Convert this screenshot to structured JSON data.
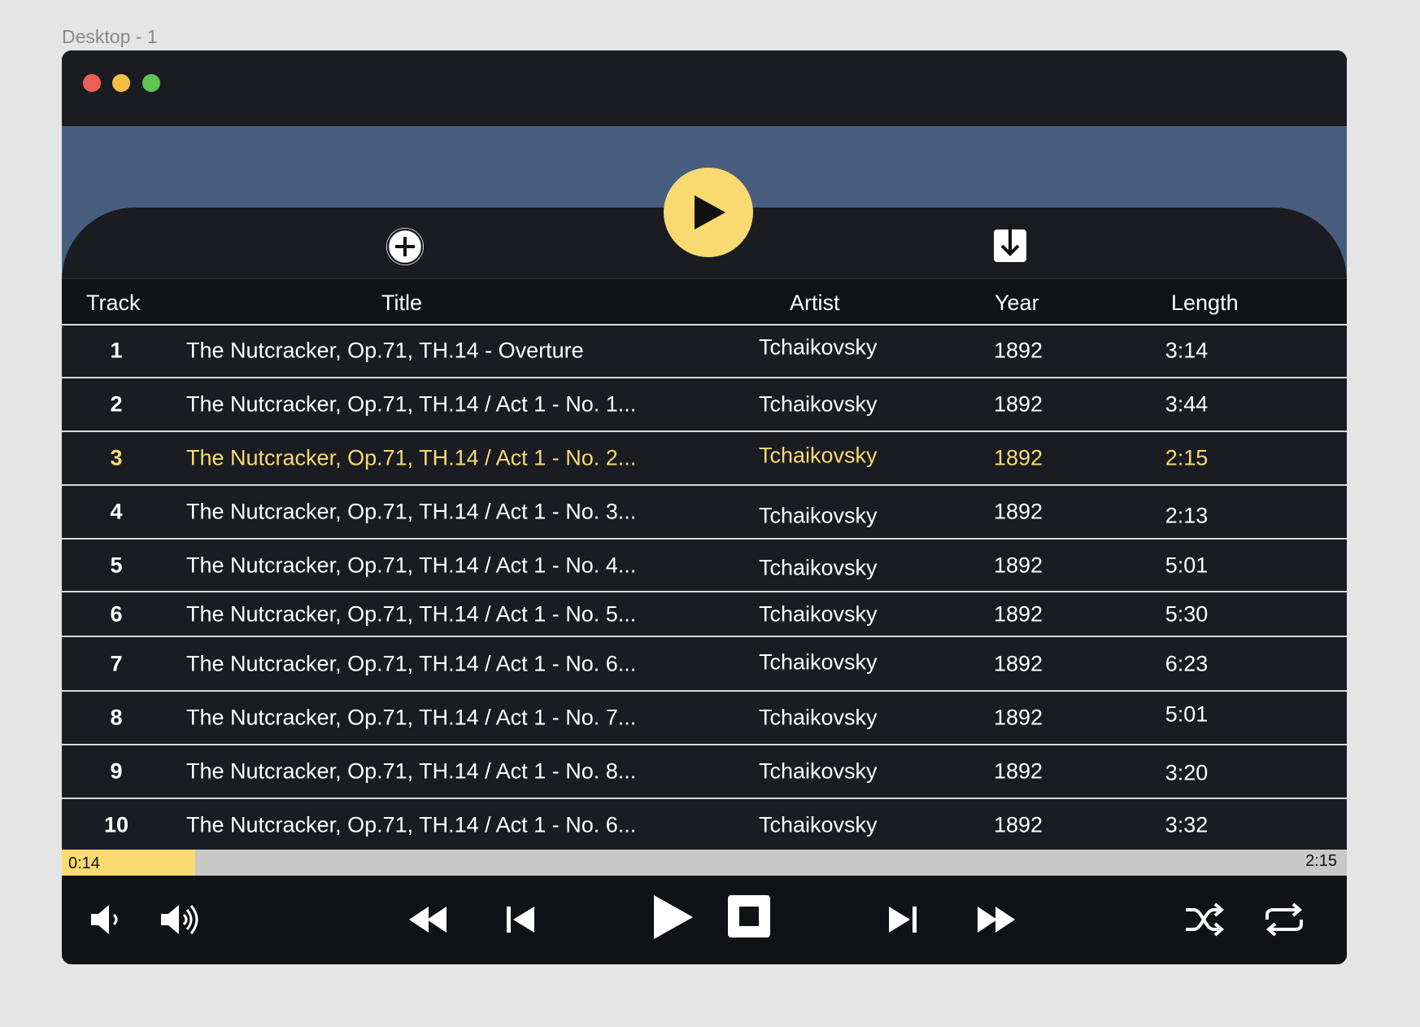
{
  "frame_label": "Desktop - 1",
  "colors": {
    "accent": "#f9da71",
    "banner": "#465d7e",
    "background": "#1a1c22",
    "traffic_red": "#ee5e57",
    "traffic_yellow": "#f4bd45",
    "traffic_green": "#5ec553"
  },
  "icons": {
    "big_play": "play-icon",
    "add": "plus-circle-icon",
    "download": "download-icon",
    "volume_low": "volume-low-icon",
    "volume_high": "volume-high-icon",
    "rewind": "rewind-icon",
    "previous": "skip-back-icon",
    "play": "play-icon",
    "stop": "stop-icon",
    "next": "skip-forward-icon",
    "fast_forward": "fast-forward-icon",
    "shuffle": "shuffle-icon",
    "repeat": "repeat-icon"
  },
  "table": {
    "headers": {
      "track": "Track",
      "title": "Title",
      "artist": "Artist",
      "year": "Year",
      "length": "Length"
    },
    "rows": [
      {
        "track": "1",
        "title": "The Nutcracker, Op.71, TH.14 - Overture",
        "artist": "Tchaikovsky",
        "year": "1892",
        "length": "3:14"
      },
      {
        "track": "2",
        "title": "The Nutcracker, Op.71, TH.14 / Act 1 - No. 1...",
        "artist": "Tchaikovsky",
        "year": "1892",
        "length": "3:44"
      },
      {
        "track": "3",
        "title": "The Nutcracker, Op.71, TH.14 / Act 1 - No. 2...",
        "artist": "Tchaikovsky",
        "year": "1892",
        "length": "2:15"
      },
      {
        "track": "4",
        "title": "The Nutcracker, Op.71, TH.14 / Act 1 - No. 3...",
        "artist": "Tchaikovsky",
        "year": "1892",
        "length": "2:13"
      },
      {
        "track": "5",
        "title": "The Nutcracker, Op.71, TH.14 / Act 1 - No. 4...",
        "artist": "Tchaikovsky",
        "year": "1892",
        "length": "5:01"
      },
      {
        "track": "6",
        "title": "The Nutcracker, Op.71, TH.14 / Act 1 - No. 5...",
        "artist": "Tchaikovsky",
        "year": "1892",
        "length": "5:30"
      },
      {
        "track": "7",
        "title": "The Nutcracker, Op.71, TH.14 / Act 1 - No. 6...",
        "artist": "Tchaikovsky",
        "year": "1892",
        "length": "6:23"
      },
      {
        "track": "8",
        "title": "The Nutcracker, Op.71, TH.14 / Act 1 - No. 7...",
        "artist": "Tchaikovsky",
        "year": "1892",
        "length": "5:01"
      },
      {
        "track": "9",
        "title": "The Nutcracker, Op.71, TH.14 / Act 1 - No. 8...",
        "artist": "Tchaikovsky",
        "year": "1892",
        "length": "3:20"
      },
      {
        "track": "10",
        "title": "The Nutcracker, Op.71, TH.14 / Act 1 - No. 6...",
        "artist": "Tchaikovsky",
        "year": "1892",
        "length": "3:32"
      }
    ],
    "active_track": "3"
  },
  "player": {
    "current_time": "0:14",
    "total_time": "2:15",
    "progress_fraction": 0.1037
  }
}
